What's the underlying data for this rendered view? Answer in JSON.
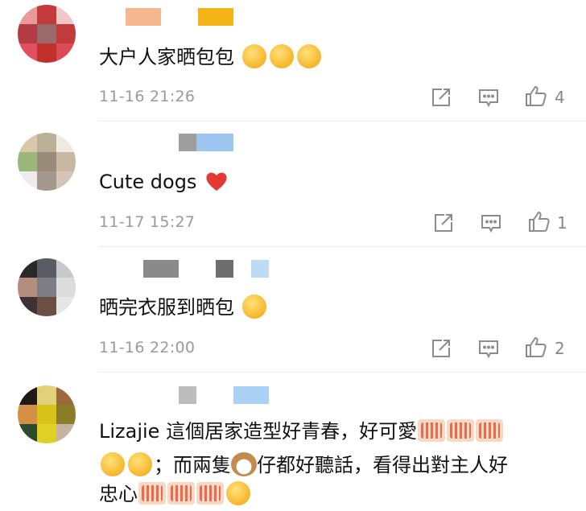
{
  "comments": [
    {
      "text": "大户人家晒包包",
      "emojis": [
        "shy-face-emoji",
        "shy-face-emoji",
        "shy-face-emoji"
      ],
      "time": "11-16 21:26",
      "likes": "4",
      "avatar_colors": [
        "#e89a9a",
        "#c23a3a",
        "#f1c7c9",
        "#b63a44",
        "#9a6a6a",
        "#c23a3a",
        "#e05060",
        "#c2302e",
        "#dc4a55"
      ],
      "name_colors": [
        "#f5b88e",
        "#f5b416"
      ]
    },
    {
      "text": "Cute dogs",
      "emojis": [
        "red-heart-emoji"
      ],
      "time": "11-17 15:27",
      "likes": "1",
      "avatar_colors": [
        "#d8c8ac",
        "#b9b096",
        "#efe9e0",
        "#9bb87a",
        "#9a8b7a",
        "#c6b8a2",
        "#ececec",
        "#a4978c",
        "#d3c4b6"
      ],
      "name_colors": [
        "#9e9e9e",
        "#9cc6f0"
      ]
    },
    {
      "text": "晒完衣服到晒包",
      "emojis": [
        "laugh-cry-emoji"
      ],
      "time": "11-16 22:00",
      "likes": "2",
      "avatar_colors": [
        "#2a2a2a",
        "#5b5b66",
        "#c7c9cc",
        "#b58d7c",
        "#7c7d86",
        "#dcdcdc",
        "#3d3236",
        "#6b4f43",
        "#e6e6e6"
      ],
      "name_colors": [
        "#8a8a8a",
        "#6e6e6e",
        "#bcdcf5"
      ]
    },
    {
      "text_line1": "Lizajie 這個居家造型好青春，好可愛",
      "text_line2_a": "；而兩隻",
      "text_line2_b": "仔都好聽話，看得出對主人好",
      "text_line3": "忠心",
      "emojis": [
        "zan-sticker",
        "smile-emoji",
        "kiss-emoji",
        "dog-emoji",
        "slight-smile-emoji"
      ],
      "avatar_colors": [
        "#1e1a18",
        "#e3d17a",
        "#9c6a3a",
        "#d59045",
        "#d6c218",
        "#8a7d2a",
        "#2c4a2e",
        "#e1cf23",
        "#c8b2a2"
      ],
      "name_colors": [
        "#bcbcbc",
        "#a9d0f5"
      ]
    }
  ],
  "colors": {
    "icon": "#8c8c8c",
    "time": "#9a9a9a",
    "divider": "#ececec"
  }
}
